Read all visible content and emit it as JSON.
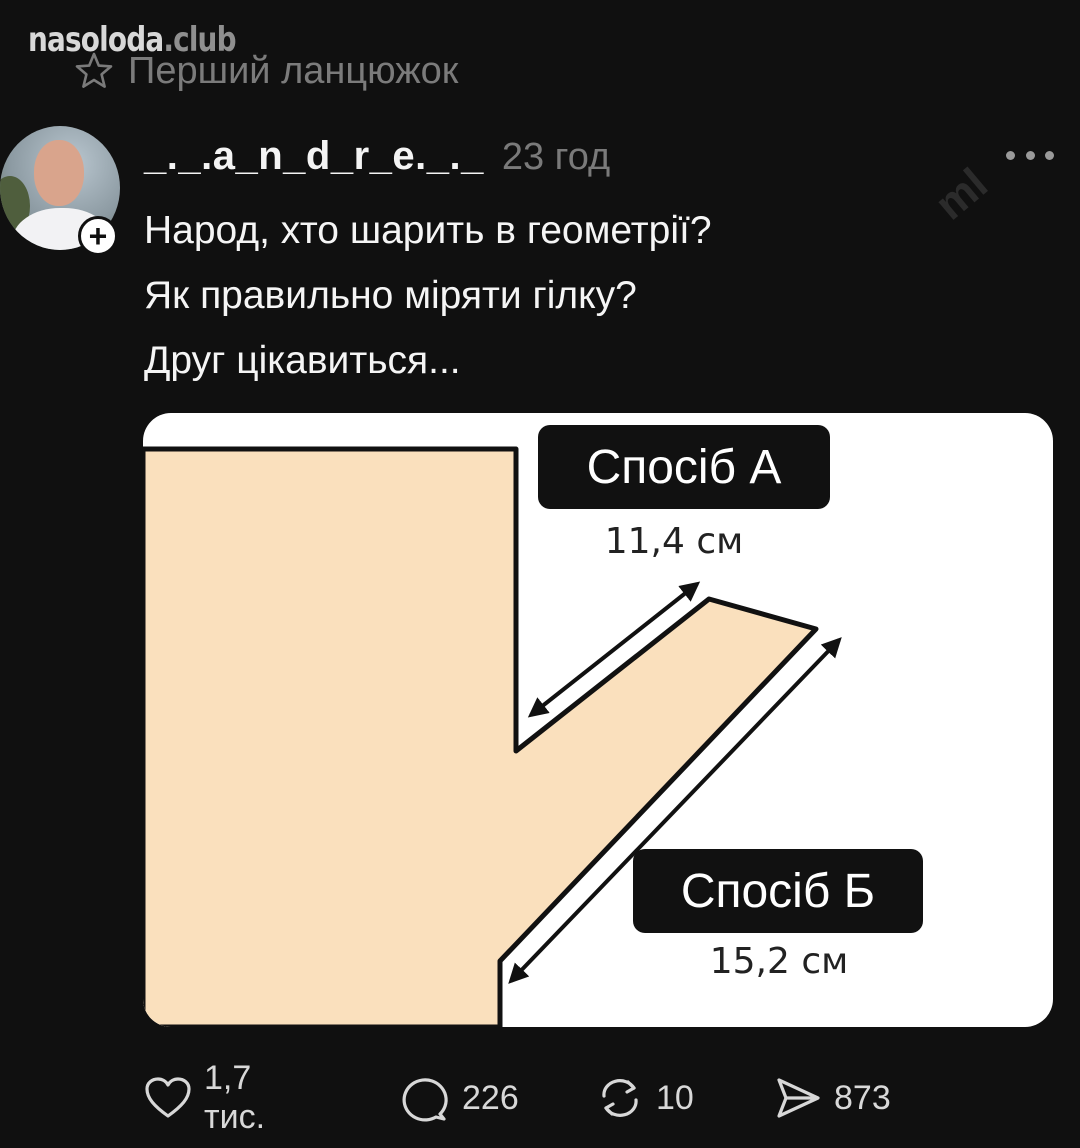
{
  "watermark": {
    "site_name": "nasoloda",
    "site_tld": ".club"
  },
  "thread": {
    "title": "Перший ланцюжок"
  },
  "post": {
    "username": "_._.a_n_d_r_e._._",
    "time": "23 год",
    "text_lines": [
      "Народ, хто шарить в геометрії?",
      "Як правильно міряти гілку?",
      "Друг цікавиться..."
    ],
    "overlay_mark": "ml"
  },
  "image": {
    "label_a": "Спосіб А",
    "measure_a": "11,4 см",
    "label_b": "Спосіб Б",
    "measure_b": "15,2 см",
    "colors": {
      "wood": "#fae0bd",
      "background": "#ffffff",
      "label_bg": "#111111"
    }
  },
  "actions": {
    "likes": "1,7 тис.",
    "replies": "226",
    "reposts": "10",
    "shares": "873"
  },
  "icons": [
    "star-icon",
    "plus-icon",
    "more-icon",
    "heart-icon",
    "comment-icon",
    "repost-icon",
    "share-icon"
  ]
}
